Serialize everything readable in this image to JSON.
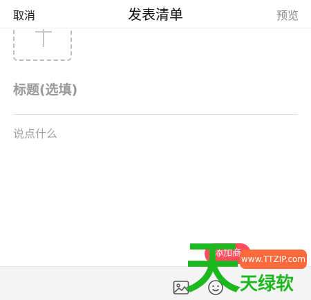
{
  "header": {
    "cancel_label": "取消",
    "title": "发表清单",
    "preview_label": "预览"
  },
  "form": {
    "title_placeholder": "标题(选填)",
    "content_placeholder": "说点什么"
  },
  "add_product_button": "添加商",
  "toolbar": {
    "icons": [
      "image-icon",
      "emoji-icon"
    ]
  },
  "watermark": {
    "big_char": "天",
    "url": "www.TTZIP.com",
    "subtitle": "天绿软"
  },
  "colors": {
    "accent": "#ff4d5e",
    "watermark_green": "#1db81f",
    "watermark_orange": "#ff6a3c"
  }
}
